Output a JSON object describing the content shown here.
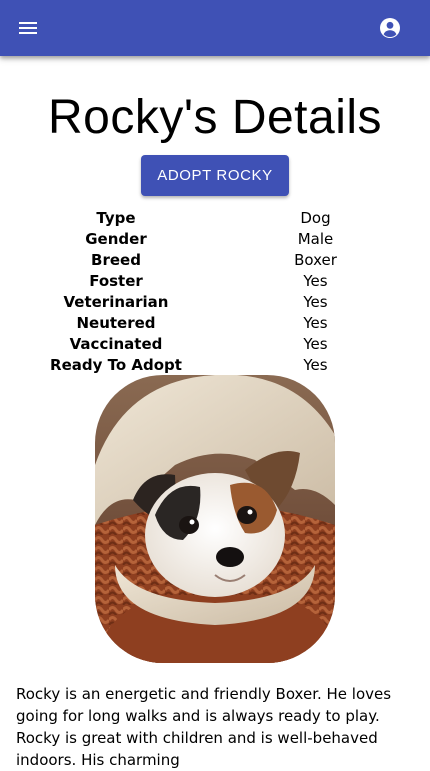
{
  "icons": {
    "menu": "menu-icon",
    "account": "account-circle-icon"
  },
  "colors": {
    "primary": "#3f51b5",
    "on_primary": "#ffffff"
  },
  "page": {
    "title": "Rocky's Details",
    "adopt_button_label": "ADOPT ROCKY"
  },
  "details": [
    {
      "label": "Type",
      "value": "Dog"
    },
    {
      "label": "Gender",
      "value": "Male"
    },
    {
      "label": "Breed",
      "value": "Boxer"
    },
    {
      "label": "Foster",
      "value": "Yes"
    },
    {
      "label": "Veterinarian",
      "value": "Yes"
    },
    {
      "label": "Neutered",
      "value": "Yes"
    },
    {
      "label": "Vaccinated",
      "value": "Yes"
    },
    {
      "label": "Ready To Adopt",
      "value": "Yes"
    }
  ],
  "description": "Rocky is an energetic and friendly Boxer. He loves going for long walks and is always ready to play. Rocky is great with children and is well-behaved indoors. His charming"
}
